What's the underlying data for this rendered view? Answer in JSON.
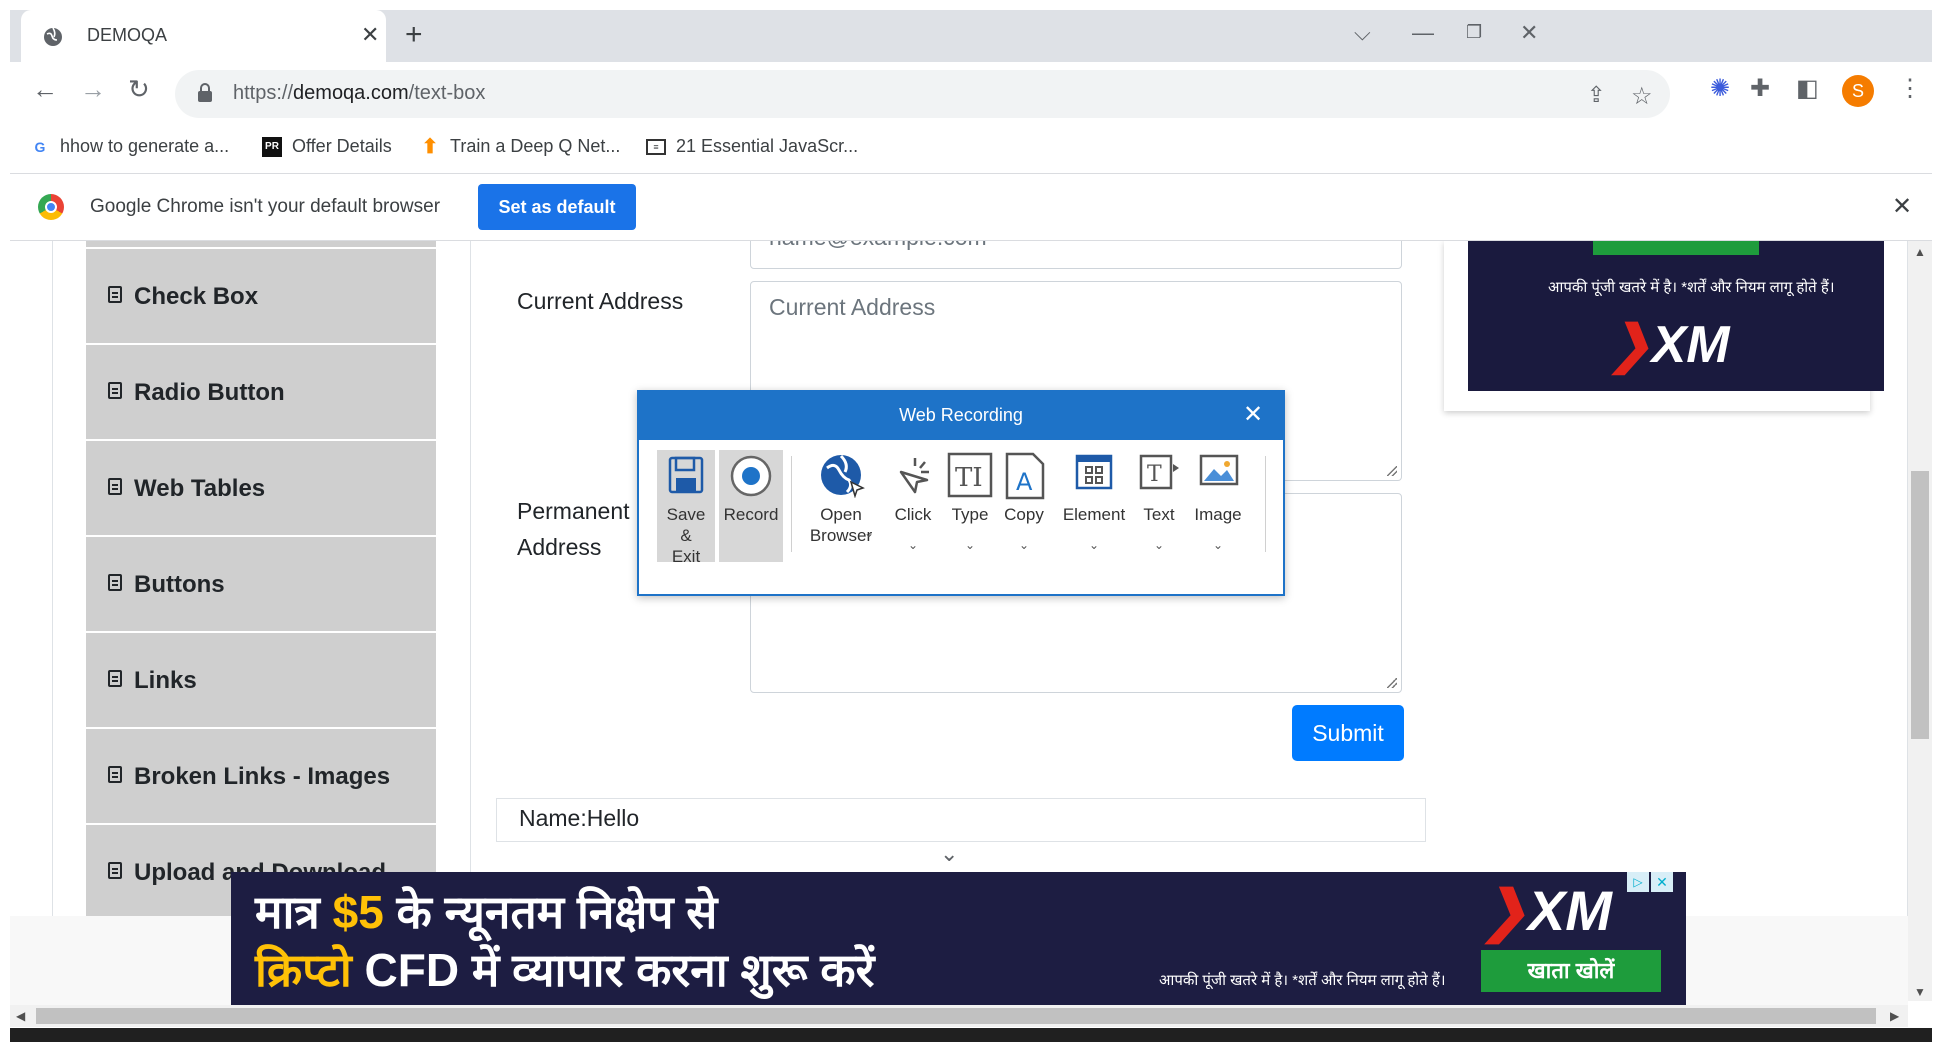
{
  "browser": {
    "tab_title": "DEMOQA",
    "url_prefix": "https://",
    "url_domain": "demoqa.com",
    "url_path": "/text-box",
    "profile_initial": "S",
    "bookmarks": [
      {
        "label": "hhow to generate a...",
        "icon": "google-icon"
      },
      {
        "label": "Offer Details",
        "icon": "pr-icon"
      },
      {
        "label": "Train a Deep Q Net...",
        "icon": "tensorflow-icon"
      },
      {
        "label": "21 Essential JavaScr...",
        "icon": "article-icon"
      }
    ],
    "infobar": {
      "message": "Google Chrome isn't your default browser",
      "button": "Set as default"
    }
  },
  "sidebar": {
    "items": [
      {
        "label": "Check Box"
      },
      {
        "label": "Radio Button"
      },
      {
        "label": "Web Tables"
      },
      {
        "label": "Buttons"
      },
      {
        "label": "Links"
      },
      {
        "label": "Broken Links - Images"
      },
      {
        "label": "Upload and Download"
      }
    ]
  },
  "form": {
    "email_placeholder": "name@example.com",
    "current_address_label": "Current Address",
    "current_address_placeholder": "Current Address",
    "permanent_address_label_1": "Permanent",
    "permanent_address_label_2": "Address",
    "submit_label": "Submit",
    "output_name": "Name:Hello"
  },
  "ads": {
    "top_disclaimer": "आपकी पूंजी खतरे में है। *शर्तें और नियम लागू होते हैं।",
    "brand": "XM",
    "bottom_line1_a": "मात्र ",
    "bottom_line1_b": "$5",
    "bottom_line1_c": " के न्यूनतम निक्षेप से",
    "bottom_line2_a": "क्रिप्टो",
    "bottom_line2_b": " CFD में  व्यापार करना शुरू करें",
    "bottom_disclaimer": "आपकी पूंजी खतरे में है। *शर्तें और नियम लागू होते हैं।",
    "bottom_cta": "खाता खोलें"
  },
  "web_recording": {
    "title": "Web Recording",
    "buttons": [
      {
        "label": "Save & Exit",
        "icon": "save-icon"
      },
      {
        "label": "Record",
        "icon": "record-icon"
      },
      {
        "label": "Open Browser",
        "icon": "globe-icon"
      },
      {
        "label": "Click",
        "icon": "click-icon"
      },
      {
        "label": "Type",
        "icon": "type-icon"
      },
      {
        "label": "Copy",
        "icon": "copy-icon"
      },
      {
        "label": "Element",
        "icon": "element-icon"
      },
      {
        "label": "Text",
        "icon": "text-icon"
      },
      {
        "label": "Image",
        "icon": "image-icon"
      }
    ]
  }
}
